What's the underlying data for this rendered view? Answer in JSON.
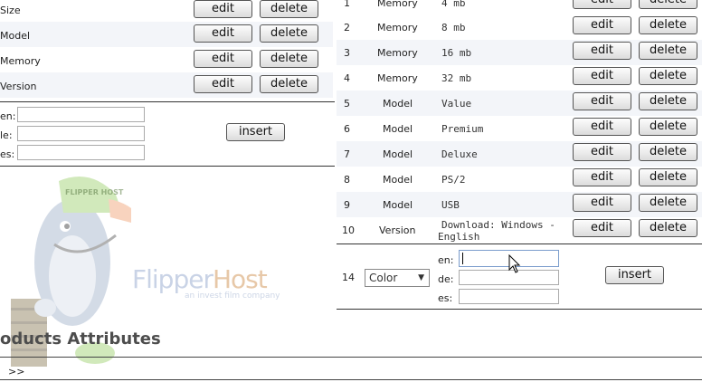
{
  "left_attributes": [
    {
      "name": "Size",
      "edit": "edit",
      "delete": "delete"
    },
    {
      "name": "Model",
      "edit": "edit",
      "delete": "delete"
    },
    {
      "name": "Memory",
      "edit": "edit",
      "delete": "delete"
    },
    {
      "name": "Version",
      "edit": "edit",
      "delete": "delete"
    }
  ],
  "left_insert": {
    "labels": [
      "en:",
      "le:",
      "es:"
    ],
    "button": "insert"
  },
  "right_values": [
    {
      "id": "1",
      "attr": "Memory",
      "value": "4 mb",
      "edit": "edit",
      "delete": "delete"
    },
    {
      "id": "2",
      "attr": "Memory",
      "value": "8 mb",
      "edit": "edit",
      "delete": "delete"
    },
    {
      "id": "3",
      "attr": "Memory",
      "value": "16 mb",
      "edit": "edit",
      "delete": "delete"
    },
    {
      "id": "4",
      "attr": "Memory",
      "value": "32 mb",
      "edit": "edit",
      "delete": "delete"
    },
    {
      "id": "5",
      "attr": "Model",
      "value": "Value",
      "edit": "edit",
      "delete": "delete"
    },
    {
      "id": "6",
      "attr": "Model",
      "value": "Premium",
      "edit": "edit",
      "delete": "delete"
    },
    {
      "id": "7",
      "attr": "Model",
      "value": "Deluxe",
      "edit": "edit",
      "delete": "delete"
    },
    {
      "id": "8",
      "attr": "Model",
      "value": "PS/2",
      "edit": "edit",
      "delete": "delete"
    },
    {
      "id": "9",
      "attr": "Model",
      "value": "USB",
      "edit": "edit",
      "delete": "delete"
    },
    {
      "id": "10",
      "attr": "Version",
      "value_line1": "Download: Windows -",
      "value_line2": "English",
      "edit": "edit",
      "delete": "delete"
    }
  ],
  "right_insert": {
    "id": "14",
    "select_value": "Color",
    "labels": [
      "en:",
      "de:",
      "es:"
    ],
    "button": "insert"
  },
  "watermark": {
    "brand_part1": "Flipper",
    "brand_part2": "Host",
    "tagline": "an invest film company",
    "cap_text": "FLIPPER HOST"
  },
  "section_title": "oducts Attributes",
  "footer_link": ">>"
}
